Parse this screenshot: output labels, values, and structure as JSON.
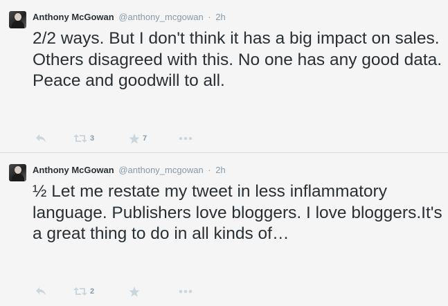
{
  "tweets": [
    {
      "name": "Anthony McGowan",
      "handle": "@anthony_mcgowan",
      "separator": "·",
      "time": "2h",
      "text": "2/2 ways. But I don't think it has a big impact on sales. Others disagreed with this. No one has any good data. Peace and goodwill to all.",
      "retweets": "3",
      "favorites": "7"
    },
    {
      "name": "Anthony McGowan",
      "handle": "@anthony_mcgowan",
      "separator": "·",
      "time": "2h",
      "text": "½ Let me restate my tweet in less inflammatory language. Publishers love bloggers. I love bloggers.It's a great thing to do in all kinds of…",
      "retweets": "2",
      "favorites": ""
    }
  ],
  "icons": {
    "reply": "reply-icon",
    "retweet": "retweet-icon",
    "favorite": "star-icon",
    "more": "more-icon"
  },
  "colors": {
    "background": "#f5f5f5",
    "text": "#292f33",
    "muted": "#8899a6",
    "icon": "#ccd6dd"
  }
}
